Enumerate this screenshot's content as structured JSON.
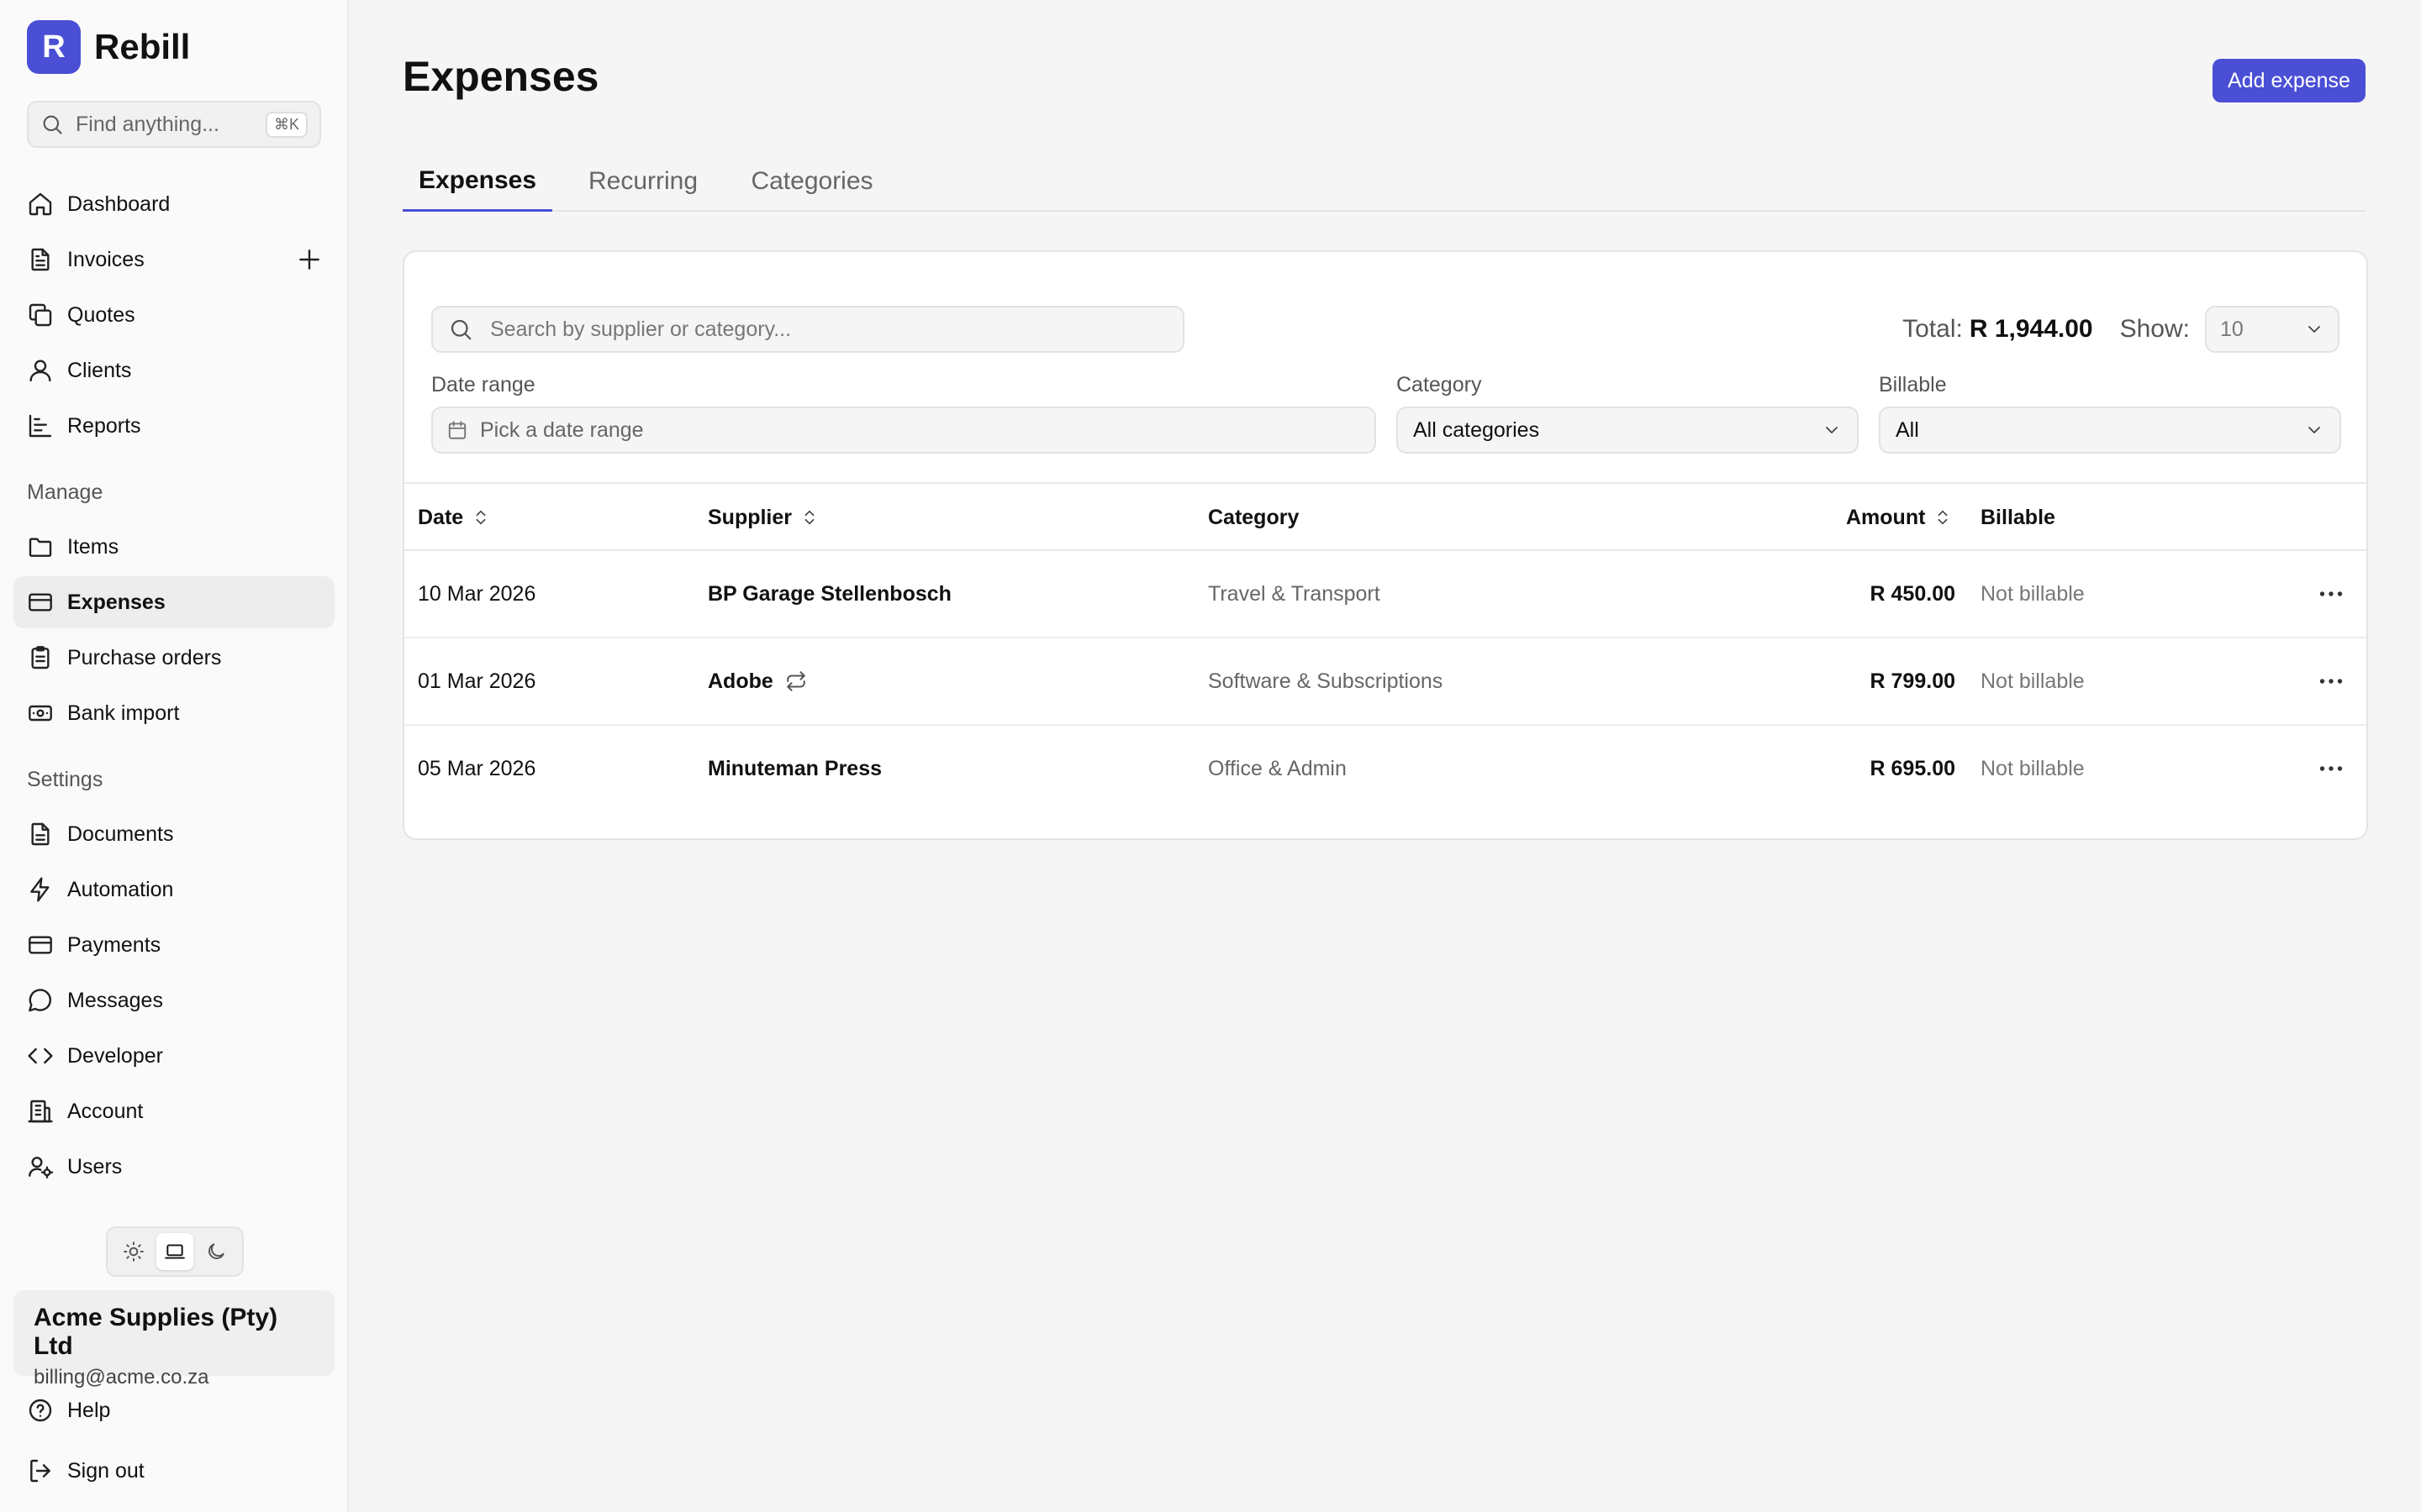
{
  "brand": {
    "logo_letter": "R",
    "name": "Rebill",
    "accent": "#4a4fd6"
  },
  "sidebar": {
    "search": {
      "placeholder": "Find anything...",
      "shortcut": "⌘K"
    },
    "main_items": [
      {
        "label": "Dashboard",
        "icon": "home-icon"
      },
      {
        "label": "Invoices",
        "icon": "document-icon"
      },
      {
        "label": "Quotes",
        "icon": "copy-icon"
      },
      {
        "label": "Clients",
        "icon": "user-icon"
      },
      {
        "label": "Reports",
        "icon": "bar-chart-icon"
      }
    ],
    "manage_label": "Manage",
    "manage_items": [
      {
        "label": "Items",
        "icon": "folder-icon"
      },
      {
        "label": "Expenses",
        "icon": "credit-card-icon",
        "active": true
      },
      {
        "label": "Purchase orders",
        "icon": "clipboard-icon"
      },
      {
        "label": "Bank import",
        "icon": "banknote-icon"
      }
    ],
    "settings_label": "Settings",
    "settings_items": [
      {
        "label": "Documents",
        "icon": "document-icon"
      },
      {
        "label": "Automation",
        "icon": "lightning-icon"
      },
      {
        "label": "Payments",
        "icon": "credit-card-icon"
      },
      {
        "label": "Messages",
        "icon": "chat-icon"
      },
      {
        "label": "Developer",
        "icon": "code-icon"
      },
      {
        "label": "Account",
        "icon": "building-icon"
      },
      {
        "label": "Users",
        "icon": "user-gear-icon"
      }
    ],
    "theme": {
      "options": [
        "light",
        "system",
        "dark"
      ],
      "selected": "system"
    },
    "account": {
      "name": "Acme Supplies (Pty) Ltd",
      "email": "billing@acme.co.za"
    },
    "bottom_items": [
      {
        "label": "Help",
        "icon": "help-circle-icon"
      },
      {
        "label": "Sign out",
        "icon": "sign-out-icon"
      }
    ]
  },
  "page": {
    "title": "Expenses",
    "add_button": "Add expense"
  },
  "tabs": [
    {
      "label": "Expenses",
      "active": true
    },
    {
      "label": "Recurring",
      "active": false
    },
    {
      "label": "Categories",
      "active": false
    }
  ],
  "toolbar": {
    "search_placeholder": "Search by supplier or category...",
    "total_label": "Total:",
    "total_value": "R 1,944.00",
    "show_label": "Show:",
    "show_value": "10"
  },
  "filters": {
    "date_label": "Date range",
    "date_placeholder": "Pick a date range",
    "category_label": "Category",
    "category_value": "All categories",
    "billable_label": "Billable",
    "billable_value": "All"
  },
  "table": {
    "columns": [
      "Date",
      "Supplier",
      "Category",
      "Amount",
      "Billable"
    ],
    "rows": [
      {
        "date": "10 Mar 2026",
        "supplier": "BP Garage Stellenbosch",
        "recurring": false,
        "category": "Travel & Transport",
        "amount": "R 450.00",
        "billable": "Not billable"
      },
      {
        "date": "01 Mar 2026",
        "supplier": "Adobe",
        "recurring": true,
        "category": "Software & Subscriptions",
        "amount": "R 799.00",
        "billable": "Not billable"
      },
      {
        "date": "05 Mar 2026",
        "supplier": "Minuteman Press",
        "recurring": false,
        "category": "Office & Admin",
        "amount": "R 695.00",
        "billable": "Not billable"
      }
    ]
  }
}
